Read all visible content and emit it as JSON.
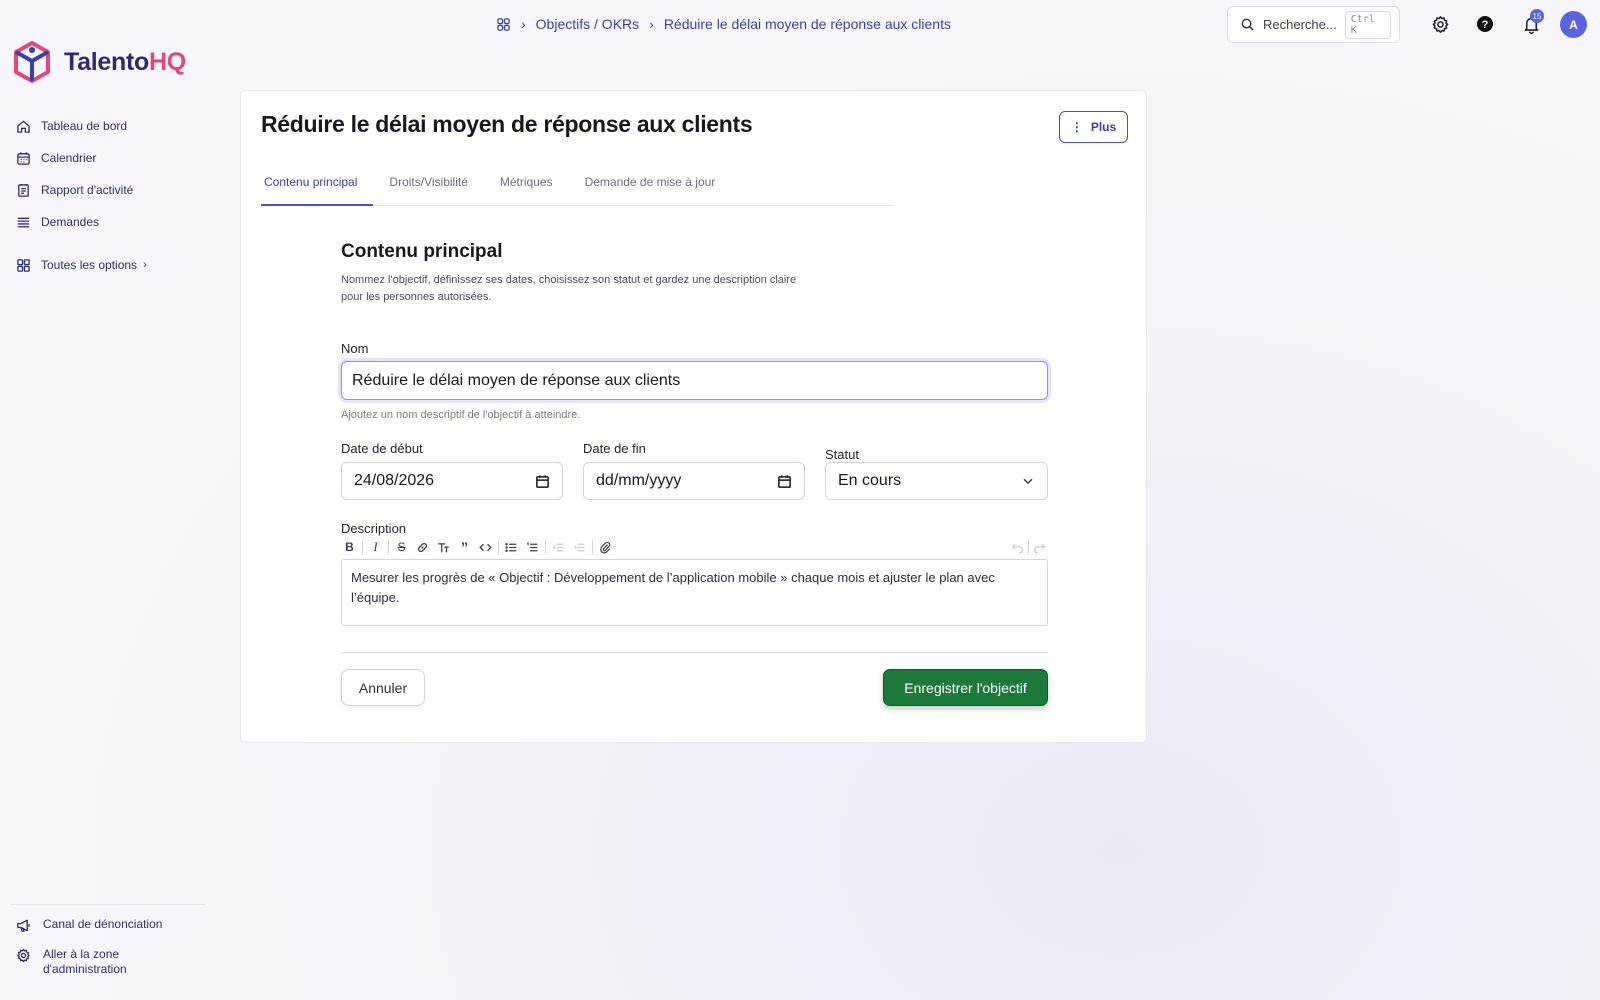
{
  "brand": {
    "name_part1": "Talento",
    "name_part2": "HQ"
  },
  "breadcrumb": {
    "section": "Objectifs / OKRs",
    "current": "Réduire le délai moyen de réponse aux clients"
  },
  "search": {
    "placeholder": "Recherche...",
    "shortcut": "Ctrl K"
  },
  "notifications": {
    "count": "15"
  },
  "user": {
    "initial": "A"
  },
  "sidebar": {
    "items": [
      {
        "label": "Tableau de bord",
        "icon": "home-icon"
      },
      {
        "label": "Calendrier",
        "icon": "calendar-icon"
      },
      {
        "label": "Rapport d'activité",
        "icon": "report-icon"
      },
      {
        "label": "Demandes",
        "icon": "list-icon"
      }
    ],
    "all_options": "Toutes les options",
    "footer": {
      "whistleblow": "Canal de dénonciation",
      "admin": "Aller à la zone d'administration"
    }
  },
  "page": {
    "title": "Réduire le délai moyen de réponse aux clients",
    "more_button": "Plus",
    "tabs": [
      "Contenu principal",
      "Droits/Visibilité",
      "Métriques",
      "Demande de mise à jour"
    ],
    "active_tab": 0
  },
  "form": {
    "section_title": "Contenu principal",
    "section_desc": "Nommez l'objectif, définissez ses dates, choisissez son statut et gardez une description claire pour les personnes autorisées.",
    "name_label": "Nom",
    "name_value": "Réduire le délai moyen de réponse aux clients",
    "name_help": "Ajoutez un nom descriptif de l'objectif à atteindre.",
    "start_label": "Date de début",
    "start_value": "24/08/2026",
    "end_label": "Date de fin",
    "end_placeholder": "dd/mm/yyyy",
    "status_label": "Statut",
    "status_value": "En cours",
    "description_label": "Description",
    "description_value": "Mesurer les progrès de « Objectif : Développement de l’application mobile » chaque mois et ajuster le plan avec l’équipe.",
    "cancel": "Annuler",
    "save": "Enregistrer l'objectif"
  },
  "colors": {
    "accent": "#4b50c2",
    "brand_pink": "#e4487a",
    "success": "#1e7a3c"
  }
}
